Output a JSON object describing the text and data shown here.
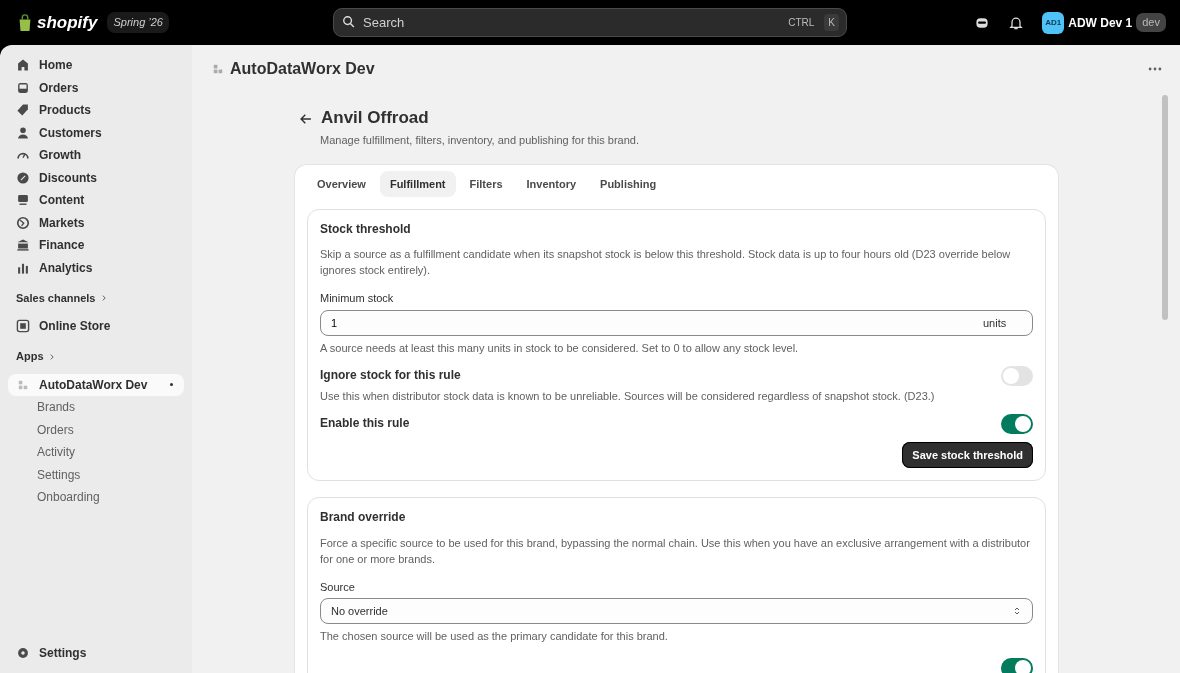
{
  "topbar": {
    "brand": "shopify",
    "edition": "Spring ’26",
    "search": {
      "placeholder": "Search",
      "shortcut": [
        "CTRL",
        "K"
      ]
    },
    "avatar": "AD1",
    "user": "ADW Dev 1",
    "user_badge": "dev"
  },
  "sidebar": {
    "items": [
      {
        "label": "Home",
        "selected": false
      },
      {
        "label": "Orders",
        "selected": false
      },
      {
        "label": "Products",
        "selected": false
      },
      {
        "label": "Customers",
        "selected": false
      },
      {
        "label": "Growth",
        "selected": false
      },
      {
        "label": "Discounts",
        "selected": false
      },
      {
        "label": "Content",
        "selected": false
      },
      {
        "label": "Markets",
        "selected": false
      },
      {
        "label": "Finance",
        "selected": false
      },
      {
        "label": "Analytics",
        "selected": false
      }
    ],
    "sections": [
      {
        "title": "Sales channels",
        "items": [
          {
            "label": "Online Store",
            "selected": false
          }
        ]
      },
      {
        "title": "Apps",
        "items": [
          {
            "label": "AutoDataWorx Dev",
            "selected": true,
            "pinned": true,
            "children": [
              {
                "label": "Brands",
                "selected": false
              },
              {
                "label": "Orders",
                "selected": false
              },
              {
                "label": "Activity",
                "selected": false
              },
              {
                "label": "Settings",
                "selected": false
              },
              {
                "label": "Onboarding",
                "selected": false
              }
            ]
          }
        ]
      }
    ],
    "footer": {
      "label": "Settings"
    }
  },
  "app_header": {
    "title": "AutoDataWorx Dev"
  },
  "page": {
    "title": "Anvil Offroad",
    "subtitle": "Manage fulfillment, filters, inventory, and publishing for this brand.",
    "tabs": [
      {
        "label": "Overview",
        "selected": false
      },
      {
        "label": "Fulfillment",
        "selected": true
      },
      {
        "label": "Filters",
        "selected": false
      },
      {
        "label": "Inventory",
        "selected": false
      },
      {
        "label": "Publishing",
        "selected": false
      }
    ],
    "sections": [
      {
        "title": "Stock threshold",
        "description": "Skip a source as a fulfillment candidate when its snapshot stock is below this threshold. Stock data is up to four hours old (D23 override below ignores stock entirely).",
        "fields": [
          {
            "kind": "number",
            "label": "Minimum stock",
            "value": "1",
            "suffix": "units",
            "help": "A source needs at least this many units in stock to be considered. Set to 0 to allow any stock level."
          },
          {
            "kind": "toggle",
            "label": "Ignore stock for this rule",
            "help": "Use this when distributor stock data is known to be unreliable. Sources will be considered regardless of snapshot stock. (D23.)",
            "on": false
          },
          {
            "kind": "toggle",
            "label": "Enable this rule",
            "on": true
          }
        ],
        "button": "Save stock threshold"
      },
      {
        "title": "Brand override",
        "description": "Force a specific source to be used for this brand, bypassing the normal chain. Use this when you have an exclusive arrangement with a distributor for one or more brands.",
        "fields": [
          {
            "kind": "select",
            "label": "Source",
            "value": "No override",
            "help": "The chosen source will be used as the primary candidate for this brand."
          },
          {
            "kind": "toggle",
            "on": true
          }
        ]
      }
    ]
  }
}
